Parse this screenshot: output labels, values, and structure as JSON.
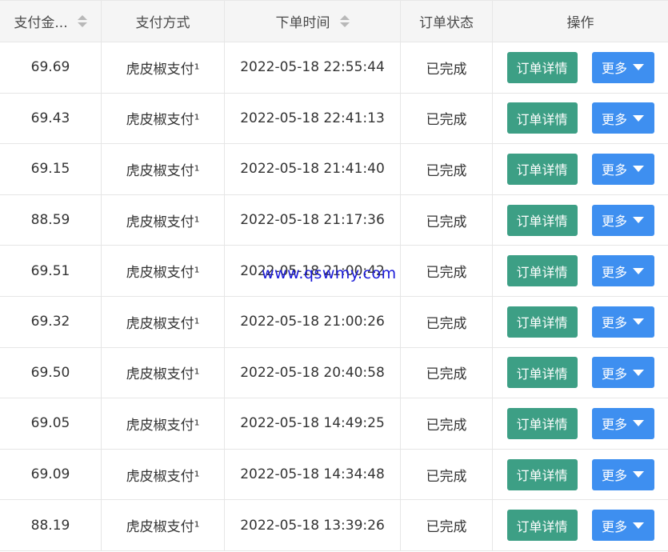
{
  "headers": {
    "amount": "支付金...",
    "method": "支付方式",
    "time": "下单时间",
    "status": "订单状态",
    "action": "操作"
  },
  "buttons": {
    "detail": "订单详情",
    "more": "更多"
  },
  "rows": [
    {
      "amount": "69.69",
      "method": "虎皮椒支付¹",
      "time": "2022-05-18 22:55:44",
      "status": "已完成"
    },
    {
      "amount": "69.43",
      "method": "虎皮椒支付¹",
      "time": "2022-05-18 22:41:13",
      "status": "已完成"
    },
    {
      "amount": "69.15",
      "method": "虎皮椒支付¹",
      "time": "2022-05-18 21:41:40",
      "status": "已完成"
    },
    {
      "amount": "88.59",
      "method": "虎皮椒支付¹",
      "time": "2022-05-18 21:17:36",
      "status": "已完成"
    },
    {
      "amount": "69.51",
      "method": "虎皮椒支付¹",
      "time": "2022-05-18 21:00:42",
      "status": "已完成"
    },
    {
      "amount": "69.32",
      "method": "虎皮椒支付¹",
      "time": "2022-05-18 21:00:26",
      "status": "已完成"
    },
    {
      "amount": "69.50",
      "method": "虎皮椒支付¹",
      "time": "2022-05-18 20:40:58",
      "status": "已完成"
    },
    {
      "amount": "69.05",
      "method": "虎皮椒支付¹",
      "time": "2022-05-18 14:49:25",
      "status": "已完成"
    },
    {
      "amount": "69.09",
      "method": "虎皮椒支付¹",
      "time": "2022-05-18 14:34:48",
      "status": "已完成"
    },
    {
      "amount": "88.19",
      "method": "虎皮椒支付¹",
      "time": "2022-05-18 13:39:26",
      "status": "已完成"
    }
  ],
  "watermark": "www.qswmy.com",
  "colors": {
    "detail_button": "#3d9f85",
    "more_button": "#3e8ff0",
    "header_bg": "#f5f5f5",
    "watermark": "#1a1ad8"
  }
}
